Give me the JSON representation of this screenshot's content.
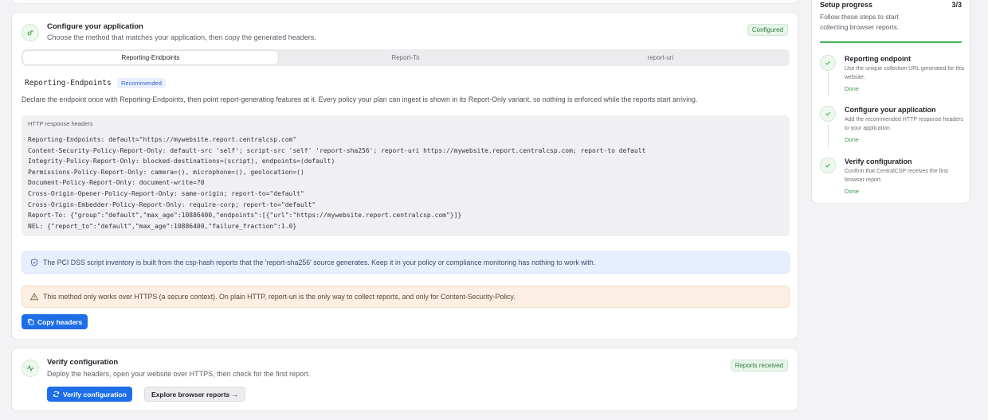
{
  "configure": {
    "title": "Configure your application",
    "subtitle": "Choose the method that matches your application, then copy the generated headers.",
    "badge": "Configured",
    "tabs": [
      "Reporting-Endpoints",
      "Report-To",
      "report-uri"
    ],
    "active_tab": "Reporting-Endpoints",
    "section_name": "Reporting-Endpoints",
    "recommended": "Recommended",
    "description": "Declare the endpoint once with Reporting-Endpoints, then point report-generating features at it. Every policy your plan can ingest is shown in its Report-Only variant, so nothing is enforced while the reports start arriving.",
    "code_label": "HTTP response headers",
    "code_lines": [
      "Reporting-Endpoints: default=\"https://mywebsite.report.centralcsp.com\"",
      "Content-Security-Policy-Report-Only: default-src 'self'; script-src 'self' 'report-sha256'; report-uri https://mywebsite.report.centralcsp.com; report-to default",
      "Integrity-Policy-Report-Only: blocked-destinations=(script), endpoints=(default)",
      "Permissions-Policy-Report-Only: camera=(), microphone=(), geolocation=()",
      "Document-Policy-Report-Only: document-write=?0",
      "Cross-Origin-Opener-Policy-Report-Only: same-origin; report-to=\"default\"",
      "Cross-Origin-Embedder-Policy-Report-Only: require-corp; report-to=\"default\"",
      "Report-To: {\"group\":\"default\",\"max_age\":10886400,\"endpoints\":[{\"url\":\"https://mywebsite.report.centralcsp.com\"}]}",
      "NEL: {\"report_to\":\"default\",\"max_age\":10886400,\"failure_fraction\":1.0}"
    ],
    "info_text": "The PCI DSS script inventory is built from the csp-hash reports that the 'report-sha256' source generates. Keep it in your policy or compliance monitoring has nothing to work with.",
    "warning_text": "This method only works over HTTPS (a secure context). On plain HTTP, report-uri is the only way to collect reports, and only for Content-Security-Policy.",
    "copy_button": "Copy headers"
  },
  "verify": {
    "title": "Verify configuration",
    "subtitle": "Deploy the headers, open your website over HTTPS, then check for the first report.",
    "badge": "Reports received",
    "verify_button": "Verify configuration",
    "explore_button": "Explore browser reports →"
  },
  "sidebar": {
    "title": "Setup progress",
    "count": "3/3",
    "subtitle": "Follow these steps to start collecting browser reports.",
    "steps": [
      {
        "title": "Reporting endpoint",
        "desc": "Use the unique collection URL generated for this website.",
        "status": "Done"
      },
      {
        "title": "Configure your application",
        "desc": "Add the recommended HTTP response headers to your application.",
        "status": "Done"
      },
      {
        "title": "Verify configuration",
        "desc": "Confirm that CentralCSP receives the first browser report.",
        "status": "Done"
      }
    ]
  },
  "colors": {
    "primary": "#1d6ee8",
    "success": "#3db453",
    "info_bg": "#e7efff",
    "warning_bg": "#fcefe3"
  }
}
